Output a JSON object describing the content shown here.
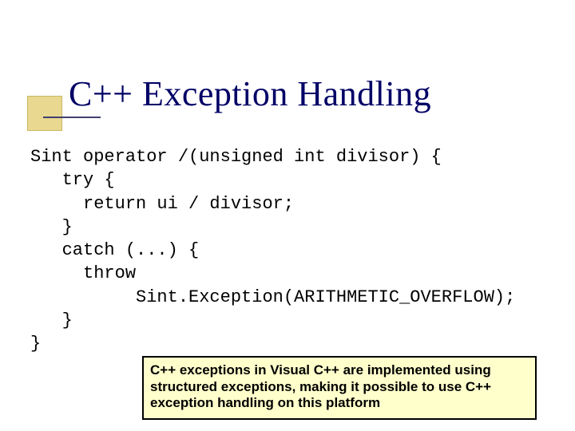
{
  "title": "C++ Exception Handling",
  "code": {
    "line1": "Sint operator /(unsigned int divisor) {",
    "line2": "   try {",
    "line3": "     return ui / divisor;",
    "line4": "   }",
    "line5": "   catch (...) {",
    "line6": "     throw",
    "line7": "          Sint.Exception(ARITHMETIC_OVERFLOW);",
    "line8": "   }",
    "line9": "}"
  },
  "note": "C++ exceptions in Visual C++ are implemented using structured exceptions, making it possible to use C++ exception handling on this platform"
}
